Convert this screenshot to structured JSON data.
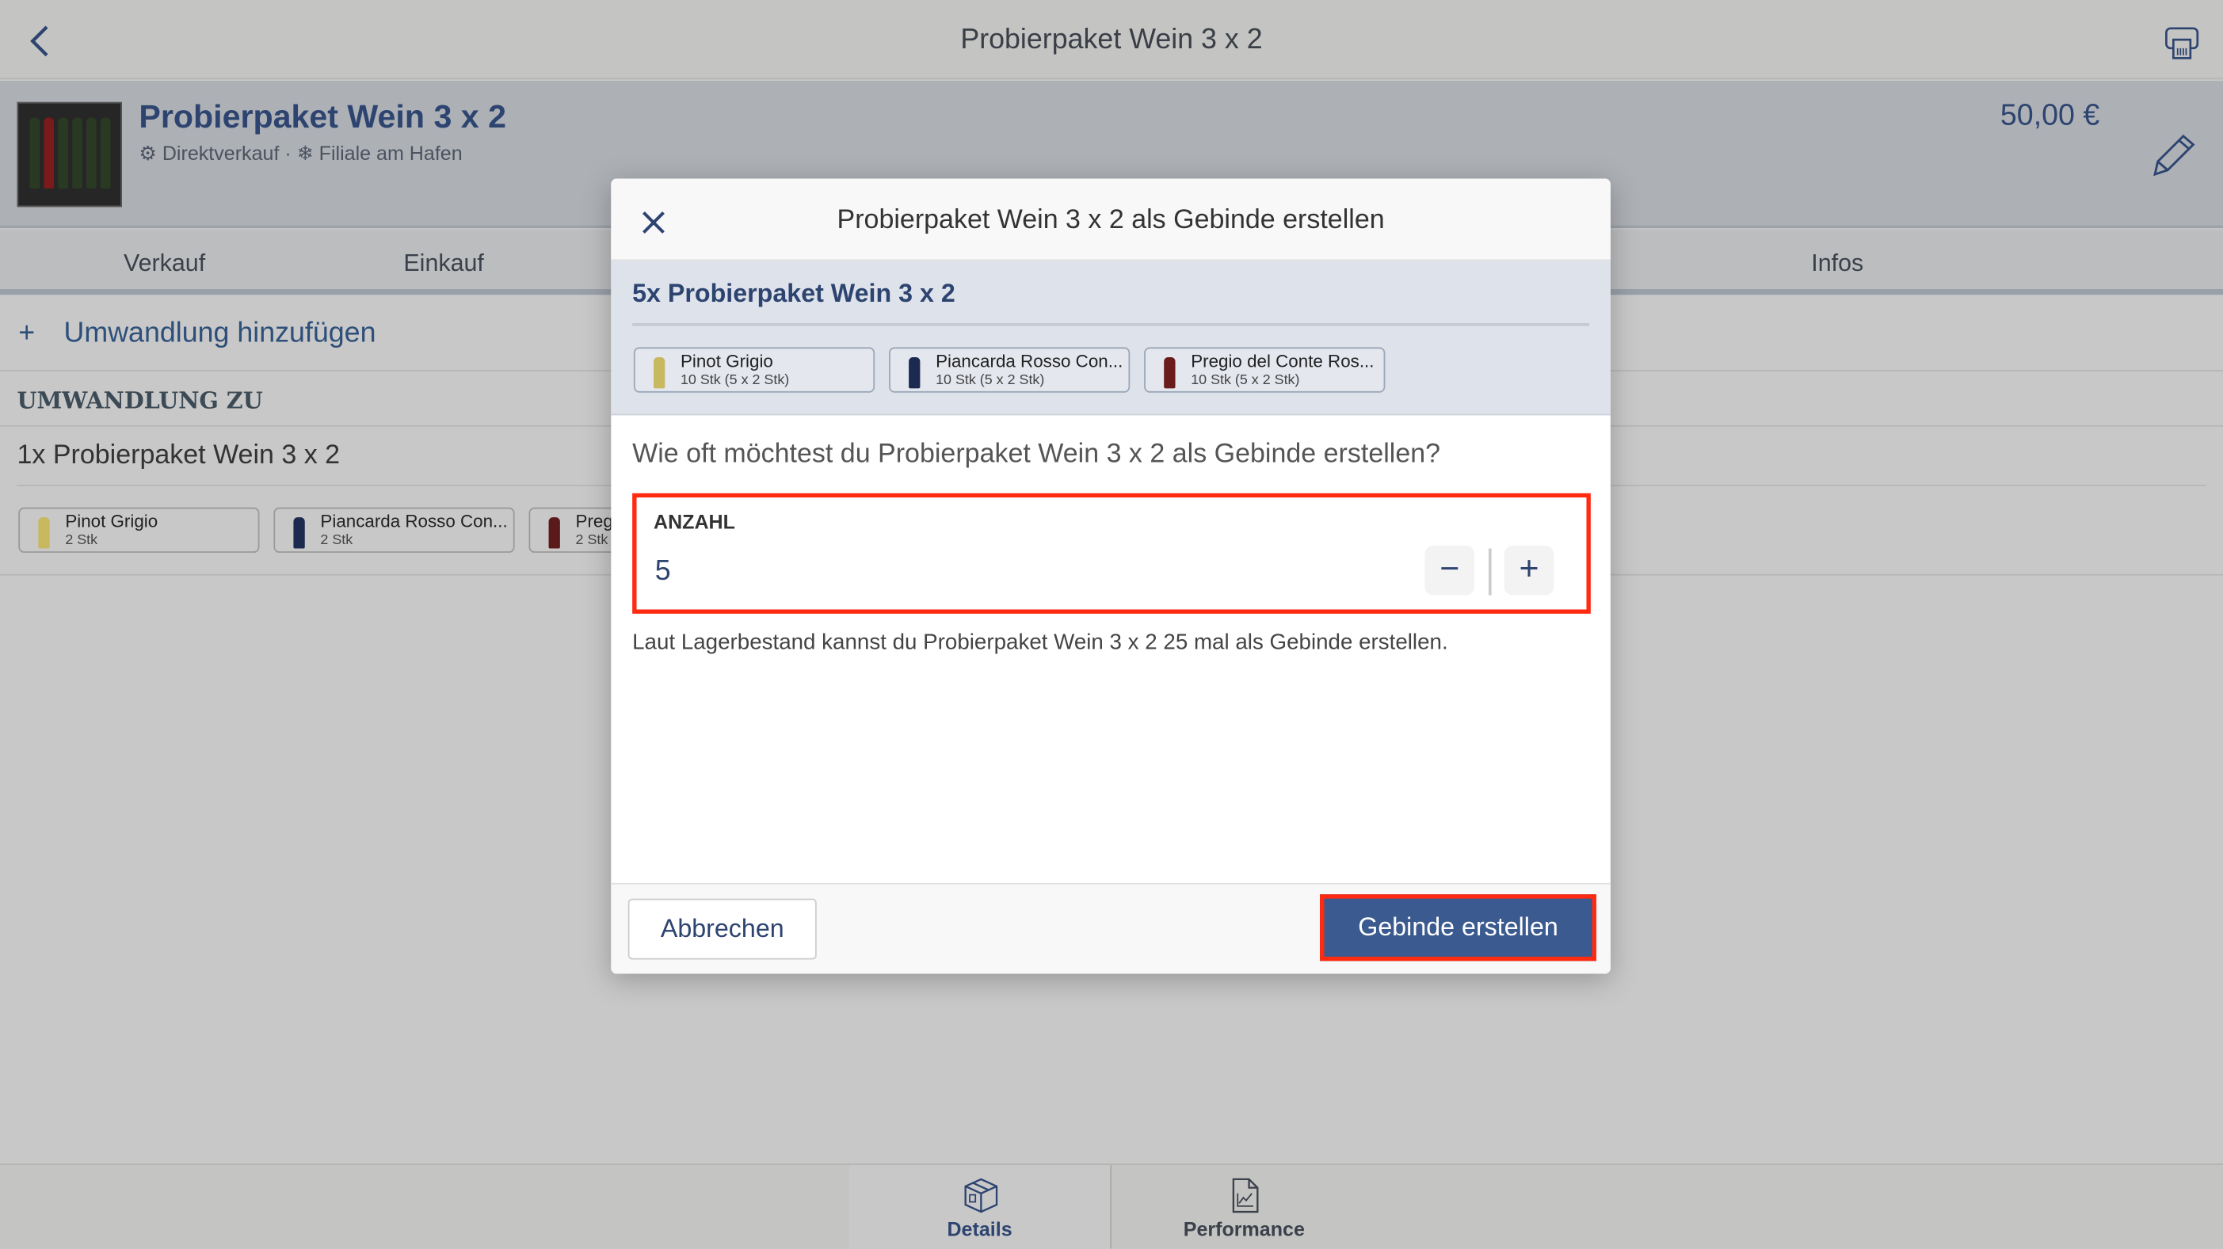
{
  "topbar": {
    "title": "Probierpaket Wein 3 x 2",
    "back_icon": "chevron-left-icon",
    "print_icon": "label-printer-icon"
  },
  "product": {
    "title": "Probierpaket Wein 3 x 2",
    "channel": "Direktverkauf",
    "separator": "·",
    "location": "Filiale am Hafen",
    "price": "50,00 €",
    "edit_icon": "pencil-icon"
  },
  "tabs": [
    {
      "label": "Verkauf"
    },
    {
      "label": "Einkauf"
    },
    {
      "label": "Infos"
    }
  ],
  "content": {
    "add_label": "Umwandlung hinzufügen",
    "section_title": "UMWANDLUNG ZU",
    "conversion_title": "1x Probierpaket Wein 3 x 2",
    "items": [
      {
        "name": "Pinot Grigio",
        "qty": "2 Stk",
        "color": "#c8b860"
      },
      {
        "name": "Piancarda Rosso Con...",
        "qty": "2 Stk",
        "color": "#1c2a50"
      },
      {
        "name": "Pregio del Conte Ros...",
        "qty": "2 Stk",
        "color": "#5a1a1a"
      }
    ]
  },
  "bottom_nav": [
    {
      "label": "Details",
      "icon": "box-icon",
      "active": true
    },
    {
      "label": "Performance",
      "icon": "chart-document-icon",
      "active": false
    }
  ],
  "dialog": {
    "title": "Probierpaket Wein 3 x 2 als Gebinde erstellen",
    "summary_title": "5x Probierpaket Wein 3 x 2",
    "items": [
      {
        "name": "Pinot Grigio",
        "qty": "10 Stk (5 x 2 Stk)",
        "color": "#c8b860"
      },
      {
        "name": "Piancarda Rosso Con...",
        "qty": "10 Stk (5 x 2 Stk)",
        "color": "#1c2a50"
      },
      {
        "name": "Pregio del Conte Ros...",
        "qty": "10 Stk (5 x 2 Stk)",
        "color": "#6a1c1c"
      }
    ],
    "question": "Wie oft möchtest du Probierpaket Wein 3 x 2 als Gebinde erstellen?",
    "field_label": "ANZAHL",
    "field_value": "5",
    "minus": "−",
    "plus": "+",
    "help": "Laut Lagerbestand kannst du Probierpaket Wein 3 x 2 25 mal als Gebinde erstellen.",
    "cancel_label": "Abbrechen",
    "confirm_label": "Gebinde erstellen"
  },
  "colors": {
    "accent": "#2d4470",
    "primary_button": "#3b5a8f",
    "highlight": "#ff2a0f"
  }
}
